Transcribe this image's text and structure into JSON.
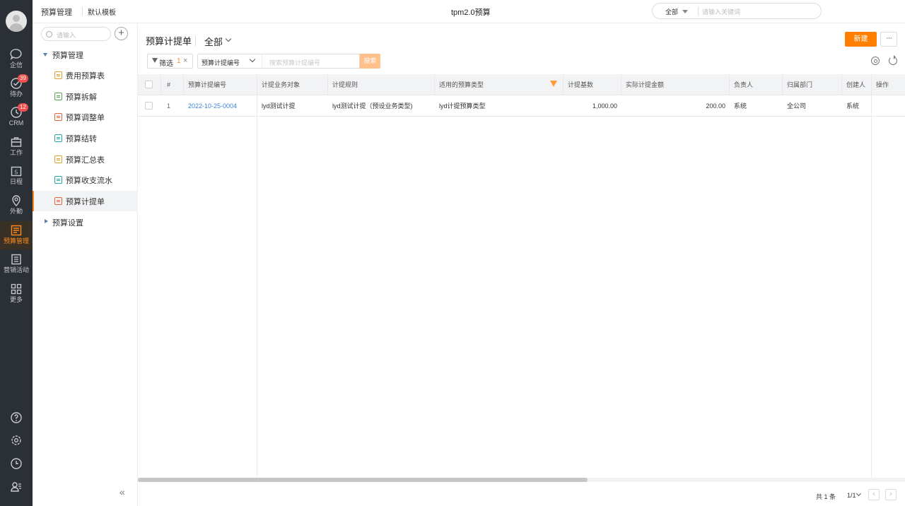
{
  "rail": {
    "items": [
      {
        "label": "企信",
        "icon": "chat-bubble-icon"
      },
      {
        "label": "待办",
        "icon": "check-circle-icon",
        "badge": "39"
      },
      {
        "label": "CRM",
        "icon": "clock-icon",
        "badge": "12"
      },
      {
        "label": "工作",
        "icon": "briefcase-icon"
      },
      {
        "label": "日程",
        "icon": "calendar-icon",
        "day": "5"
      },
      {
        "label": "外勤",
        "icon": "location-pin-icon"
      },
      {
        "label": "预算管理",
        "icon": "budget-icon",
        "active": true
      },
      {
        "label": "营销活动",
        "icon": "marketing-icon"
      },
      {
        "label": "更多",
        "icon": "grid-icon"
      }
    ],
    "bottom": [
      "help-icon",
      "settings-icon",
      "history-icon",
      "user-settings-icon"
    ]
  },
  "topbar": {
    "crumb": "预算管理",
    "template": "默认模板",
    "title": "tpm2.0预算",
    "search_scope": "全部",
    "search_placeholder": "请输入关键词"
  },
  "sidebar": {
    "search_placeholder": "请输入",
    "group": "预算管理",
    "items": [
      {
        "label": "费用预算表",
        "color": "#e0a030"
      },
      {
        "label": "预算拆解",
        "color": "#52a84a"
      },
      {
        "label": "预算调整单",
        "color": "#e0653a"
      },
      {
        "label": "预算结转",
        "color": "#2aa5a5"
      },
      {
        "label": "预算汇总表",
        "color": "#e0a030"
      },
      {
        "label": "预算收支流水",
        "color": "#2aa5a5"
      },
      {
        "label": "预算计提单",
        "color": "#e0653a",
        "selected": true
      }
    ],
    "group2": "预算设置"
  },
  "main": {
    "title": "预算计提单",
    "scope": "全部",
    "new_label": "新建",
    "more_label": "···",
    "filter_label": "筛选",
    "filter_count": "1",
    "filter_clear": "×",
    "field": "预算计提编号",
    "field_placeholder": "搜索预算计提编号",
    "search_btn": "搜索"
  },
  "table": {
    "headers": [
      "#",
      "预算计提编号",
      "计提业务对象",
      "计提规则",
      "适用的预算类型",
      "计提基数",
      "实际计提金额",
      "负责人",
      "归属部门",
      "创建人",
      "操作"
    ],
    "rows": [
      {
        "idx": "1",
        "code": "2022-10-25-0004",
        "object": "lyd测试计提",
        "rule": "lyd测试计提（预设业务类型)",
        "type": "lyd计提预算类型",
        "base": "1,000.00",
        "amount": "200.00",
        "owner": "系统",
        "dept": "全公司",
        "creator": "系统",
        "op": ""
      }
    ]
  },
  "pager": {
    "total": "共 1 条",
    "page": "1/1",
    "prev": "‹",
    "next": "›"
  }
}
